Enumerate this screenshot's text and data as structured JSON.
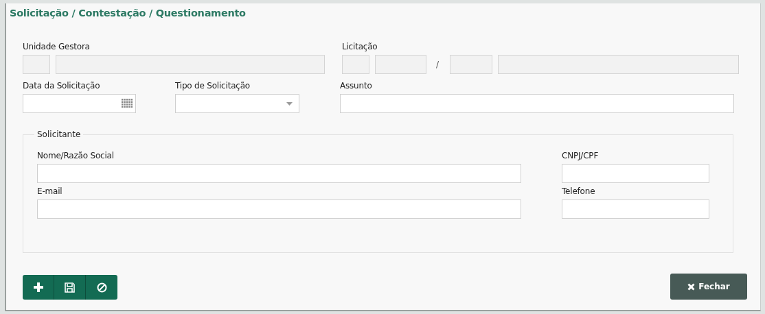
{
  "title": "Solicitação / Contestação / Questionamento",
  "rows": [
    {
      "groups": [
        {
          "label": "Unidade Gestora",
          "fields": [
            {
              "kind": "text",
              "disabled": true
            },
            {
              "kind": "text",
              "disabled": true
            }
          ]
        },
        {
          "label": "Licitação",
          "fields": [
            {
              "kind": "text",
              "disabled": true
            },
            {
              "kind": "text",
              "disabled": true
            },
            {
              "kind": "separator",
              "text": "/"
            },
            {
              "kind": "text",
              "disabled": true
            },
            {
              "kind": "text",
              "disabled": true
            }
          ]
        }
      ]
    },
    {
      "groups": [
        {
          "label": "Data da Solicitação",
          "fields": [
            {
              "kind": "date",
              "disabled": false
            }
          ]
        },
        {
          "label": "Tipo de Solicitação",
          "fields": [
            {
              "kind": "select",
              "disabled": false
            }
          ]
        },
        {
          "label": "Assunto",
          "fields": [
            {
              "kind": "text",
              "disabled": false
            }
          ]
        }
      ]
    }
  ],
  "fieldset": {
    "legend": "Solicitante",
    "rows": [
      {
        "groups": [
          {
            "label": "Nome/Razão Social",
            "fields": [
              {
                "kind": "text",
                "disabled": false
              }
            ]
          },
          {
            "label": "CNPJ/CPF",
            "fields": [
              {
                "kind": "text",
                "disabled": false
              }
            ]
          }
        ]
      },
      {
        "groups": [
          {
            "label": "E-mail",
            "fields": [
              {
                "kind": "text",
                "disabled": false
              }
            ]
          },
          {
            "label": "Telefone",
            "fields": [
              {
                "kind": "text",
                "disabled": false
              }
            ]
          }
        ]
      }
    ]
  },
  "actions": [
    {
      "kind": "add"
    },
    {
      "kind": "save"
    },
    {
      "kind": "cancel"
    }
  ],
  "close_button": {
    "label": "Fechar"
  }
}
